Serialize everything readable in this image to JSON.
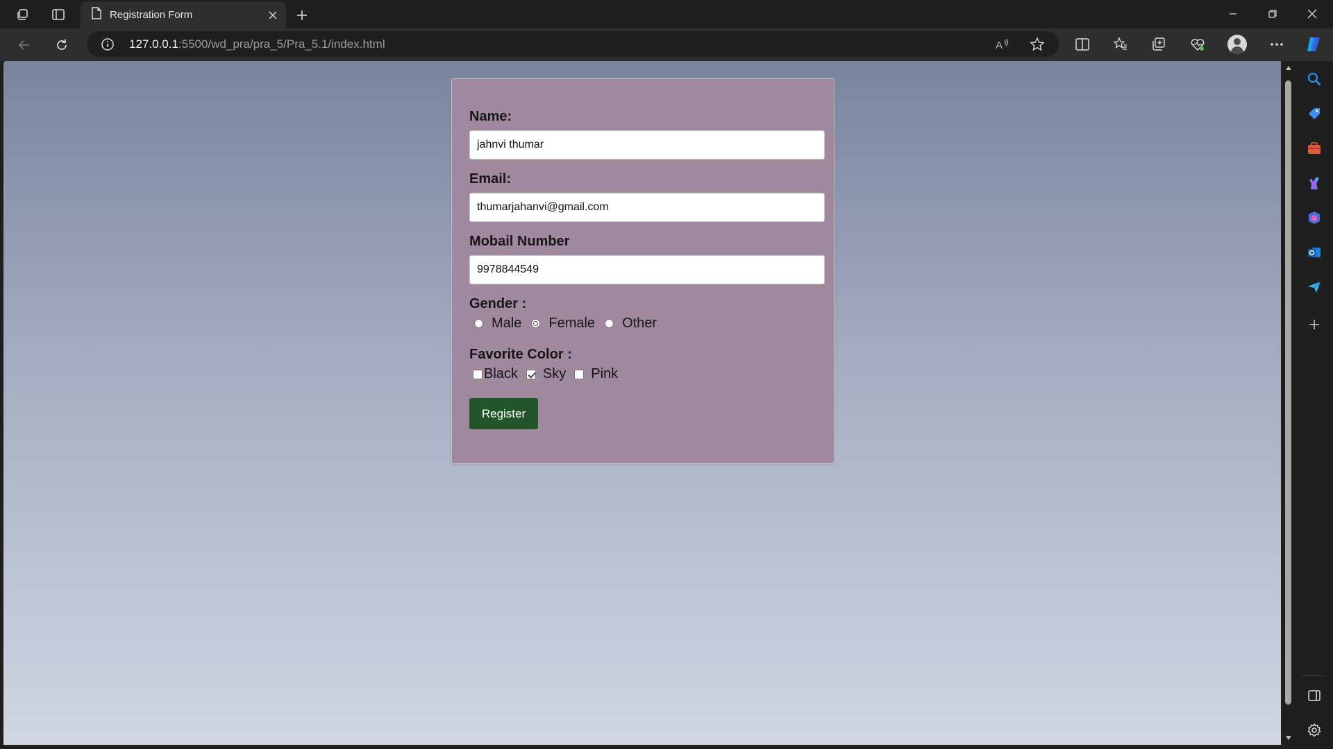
{
  "browser": {
    "tab": {
      "title": "Registration Form"
    },
    "url": {
      "host": "127.0.0.1",
      "path": ":5500/wd_pra/pra_5/Pra_5.1/index.html"
    },
    "icons": {
      "workspaces": "workspaces-icon",
      "tab_actions": "tab-actions-icon",
      "page": "page-icon",
      "read_aloud": "read-aloud-icon",
      "favorite": "star-icon",
      "split": "split-screen-icon",
      "favorites": "favorites-icon",
      "collections": "collections-icon",
      "performance": "performance-icon",
      "more": "more-icon",
      "copilot": "copilot-icon"
    },
    "sidebar_icons": [
      "search-icon",
      "shopping-icon",
      "tools-icon",
      "games-icon",
      "office-icon",
      "outlook-icon",
      "send-icon",
      "add-icon",
      "sidebar-toggle-icon",
      "settings-icon"
    ]
  },
  "form": {
    "name": {
      "label": "Name:",
      "value": "jahnvi thumar"
    },
    "email": {
      "label": "Email:",
      "value": "thumarjahanvi@gmail.com"
    },
    "mobile": {
      "label": "Mobail Number",
      "value": "9978844549"
    },
    "gender": {
      "label": "Gender :",
      "options": [
        "Male",
        "Female",
        "Other"
      ],
      "selected": "Female"
    },
    "color": {
      "label": "Favorite Color :",
      "options": [
        {
          "label": "Black",
          "checked": false
        },
        {
          "label": "Sky",
          "checked": true
        },
        {
          "label": "Pink",
          "checked": false
        }
      ]
    },
    "submit_label": "Register"
  },
  "colors": {
    "card_bg": "#a0899f",
    "button_bg": "#22552a",
    "page_gradient_top": "#7a849f",
    "page_gradient_bottom": "#d0d6e2"
  }
}
